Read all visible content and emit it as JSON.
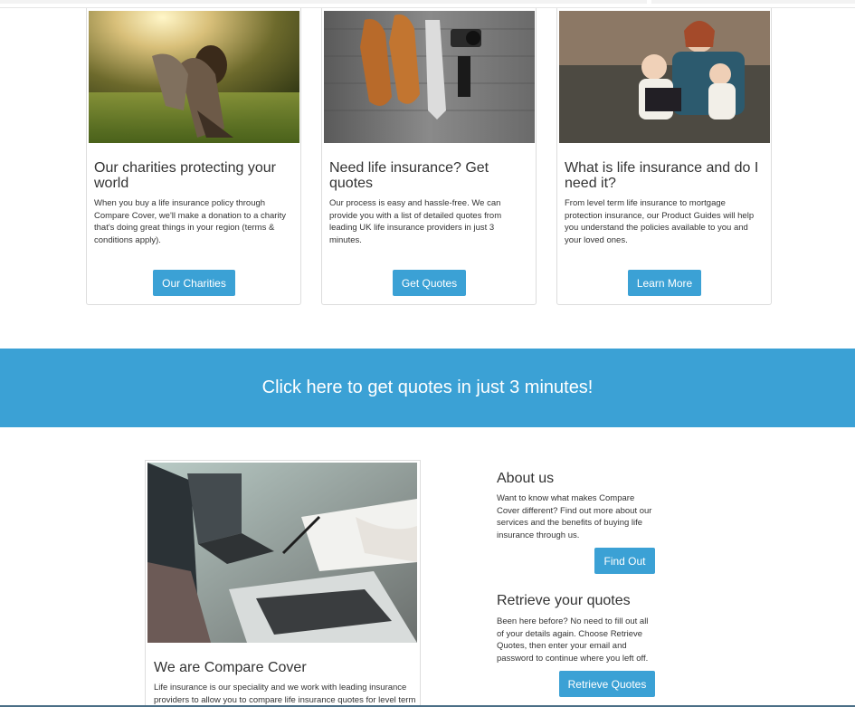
{
  "cards": [
    {
      "title": "Our charities protecting your world",
      "description": "When you buy a life insurance policy through Compare Cover, we'll make a donation to a charity that's doing great things in your region (terms & conditions apply).",
      "button_label": "Our Charities",
      "image_icon": "child-field-photo"
    },
    {
      "title": "Need life insurance? Get quotes",
      "description": "Our process is easy and hassle-free. We can provide you with a list of detailed quotes from leading UK life insurance providers in just 3 minutes.",
      "button_label": "Get Quotes",
      "image_icon": "shoes-tie-camera-photo"
    },
    {
      "title": "What is life insurance and do I need it?",
      "description": "From level term life insurance to mortgage protection insurance, our Product Guides will help you understand the policies available to you and your loved ones.",
      "button_label": "Learn More",
      "image_icon": "family-sofa-photo"
    }
  ],
  "banner": {
    "text": "Click here to get quotes in just 3 minutes!"
  },
  "feature": {
    "title": "We are Compare Cover",
    "description": "Life insurance is our speciality and we work with leading insurance providers to allow you to compare life insurance quotes for level term",
    "image_icon": "laptop-desk-photo"
  },
  "about": {
    "title": "About us",
    "description": "Want to know what makes Compare Cover different? Find out more about our services and the benefits of buying life insurance through us.",
    "button_label": "Find Out"
  },
  "retrieve": {
    "title": "Retrieve your quotes",
    "description": "Been here before? No need to fill out all of your details again. Choose Retrieve Quotes, then enter your email and password to continue where you left off.",
    "button_label": "Retrieve Quotes"
  },
  "colors": {
    "accent": "#3ba1d5",
    "text": "#333333",
    "border": "#dddddd"
  }
}
